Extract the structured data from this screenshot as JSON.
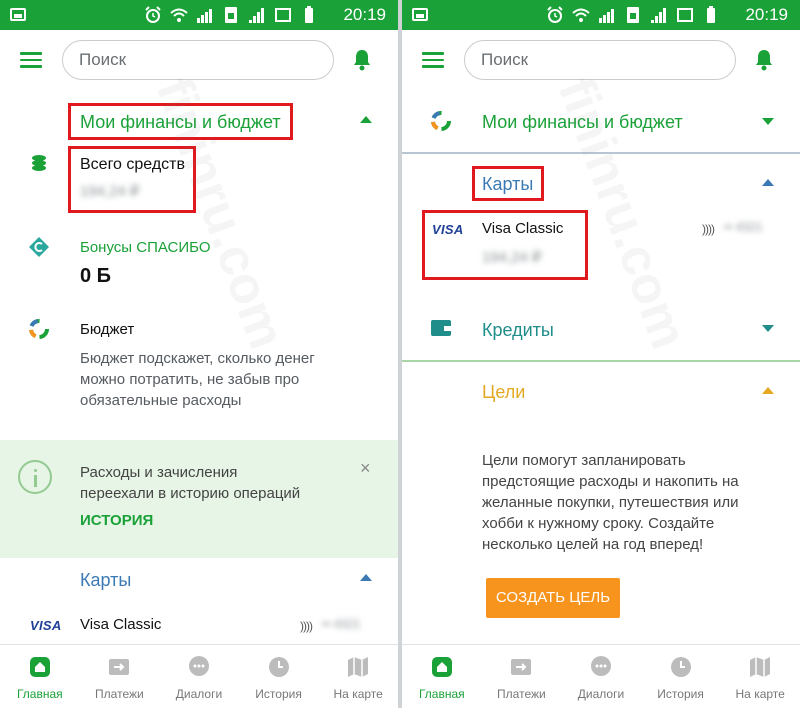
{
  "status": {
    "time": "20:19"
  },
  "search": {
    "placeholder": "Поиск"
  },
  "left": {
    "finance_title": "Мои финансы и бюджет",
    "total_label": "Всего средств",
    "total_value": "194,24 ₽",
    "bonus_label": "Бонусы СПАСИБО",
    "bonus_value": "0 Б",
    "budget_label": "Бюджет",
    "budget_desc_1": "Бюджет подскажет, сколько денег",
    "budget_desc_2": "можно потратить, не забыв про",
    "budget_desc_3": "обязательные расходы",
    "notice_line_1": "Расходы и зачисления",
    "notice_line_2": "переехали в историю операций",
    "notice_link": "ИСТОРИЯ",
    "notice_close": "×",
    "cards_title": "Карты",
    "card_brand": "VISA",
    "card_name": "Visa Classic",
    "card_nfc": "))))",
    "card_number": "•• 4321"
  },
  "right": {
    "finance_title": "Мои финансы и бюджет",
    "cards_title": "Карты",
    "card_brand": "VISA",
    "card_name": "Visa Classic",
    "card_value": "194,24 ₽",
    "card_nfc": "))))",
    "card_number": "•• 4321",
    "credits_title": "Кредиты",
    "goals_title": "Цели",
    "goals_desc_1": "Цели помогут запланировать",
    "goals_desc_2": "предстоящие расходы и накопить на",
    "goals_desc_3": "желанные покупки, путешествия или",
    "goals_desc_4": "хобби к нужному сроку. Создайте",
    "goals_desc_5": "несколько целей на год вперед!",
    "goals_button": "СОЗДАТЬ ЦЕЛЬ"
  },
  "nav": {
    "home": "Главная",
    "payments": "Платежи",
    "dialogs": "Диалоги",
    "history": "История",
    "map": "На карте"
  },
  "watermark": "fininru.com",
  "colors": {
    "brand_green": "#1aa138",
    "cards_blue": "#3b7ab4",
    "goals_orange": "#e4a823",
    "button_orange": "#f7941e",
    "highlight_red": "#e0191f"
  }
}
